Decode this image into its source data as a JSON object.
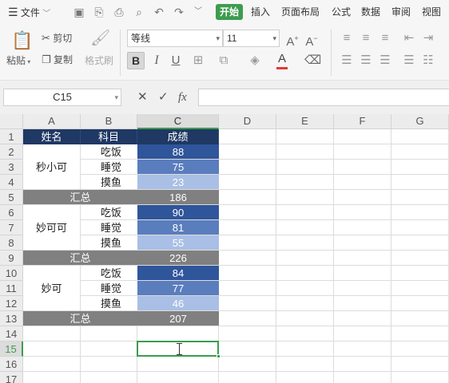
{
  "menu": {
    "file": "文件",
    "tabs": [
      "开始",
      "插入",
      "页面布局",
      "公式",
      "数据",
      "审阅",
      "视图"
    ],
    "active_tab": "开始"
  },
  "ribbon": {
    "paste": "粘贴",
    "cut": "剪切",
    "copy": "复制",
    "format_painter": "格式刷",
    "font_name": "等线",
    "font_size": "11",
    "bold": "B",
    "italic": "I",
    "underline": "U",
    "font_color_letter": "A",
    "accent_green": "#3d9c4e",
    "font_color_bar": "#e53935"
  },
  "formula_bar": {
    "name_box": "C15",
    "fx_label": "fx",
    "value": ""
  },
  "columns": [
    "A",
    "B",
    "C",
    "D",
    "E",
    "F",
    "G"
  ],
  "selected_column": "C",
  "rows": [
    "1",
    "2",
    "3",
    "4",
    "5",
    "6",
    "7",
    "8",
    "9",
    "10",
    "11",
    "12",
    "13",
    "14",
    "15",
    "16",
    "17"
  ],
  "selected_row": "15",
  "table": {
    "headers": [
      "姓名",
      "科目",
      "成绩"
    ],
    "groups": [
      {
        "name": "秒小可",
        "items": [
          {
            "subject": "吃饭",
            "score": "88"
          },
          {
            "subject": "睡觉",
            "score": "75"
          },
          {
            "subject": "摸鱼",
            "score": "23"
          }
        ],
        "total_label": "汇总",
        "total": "186"
      },
      {
        "name": "妙可可",
        "items": [
          {
            "subject": "吃饭",
            "score": "90"
          },
          {
            "subject": "睡觉",
            "score": "81"
          },
          {
            "subject": "摸鱼",
            "score": "55"
          }
        ],
        "total_label": "汇总",
        "total": "226"
      },
      {
        "name": "妙可",
        "items": [
          {
            "subject": "吃饭",
            "score": "84"
          },
          {
            "subject": "睡觉",
            "score": "77"
          },
          {
            "subject": "摸鱼",
            "score": "46"
          }
        ],
        "total_label": "汇总",
        "total": "207"
      }
    ]
  },
  "colors": {
    "header_fill": "#1f3864",
    "summary_fill": "#808080",
    "score_dark": "#2f559b",
    "score_mid": "#5a7dbd",
    "score_light": "#a9bfe5"
  }
}
